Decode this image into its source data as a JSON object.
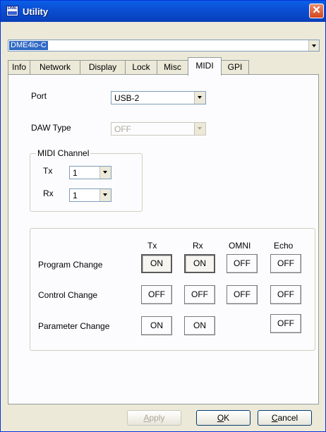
{
  "window": {
    "title": "Utility",
    "icon_text": "DME"
  },
  "device_select": {
    "value": "DME4io-C"
  },
  "tabs": [
    "Info",
    "Network",
    "Display",
    "Lock",
    "Misc",
    "MIDI",
    "GPI"
  ],
  "active_tab": "MIDI",
  "port": {
    "label": "Port",
    "value": "USB-2"
  },
  "daw_type": {
    "label": "DAW Type",
    "value": "OFF"
  },
  "midi_channel": {
    "title": "MIDI Channel",
    "tx_label": "Tx",
    "tx_value": "1",
    "rx_label": "Rx",
    "rx_value": "1"
  },
  "matrix": {
    "columns": [
      "Tx",
      "Rx",
      "OMNI",
      "Echo"
    ],
    "rows": [
      {
        "label": "Program Change",
        "cells": [
          "ON",
          "ON",
          "OFF",
          "OFF"
        ]
      },
      {
        "label": "Control Change",
        "cells": [
          "OFF",
          "OFF",
          "OFF",
          "OFF"
        ]
      },
      {
        "label": "Parameter Change",
        "cells": [
          "ON",
          "ON",
          "",
          "OFF"
        ]
      }
    ]
  },
  "buttons": {
    "apply": {
      "label": "Apply",
      "mnemonic": "A",
      "rest": "pply"
    },
    "ok": {
      "label": "OK",
      "mnemonic": "O",
      "rest": "K"
    },
    "cancel": {
      "label": "Cancel",
      "mnemonic": "C",
      "rest": "ancel"
    }
  }
}
